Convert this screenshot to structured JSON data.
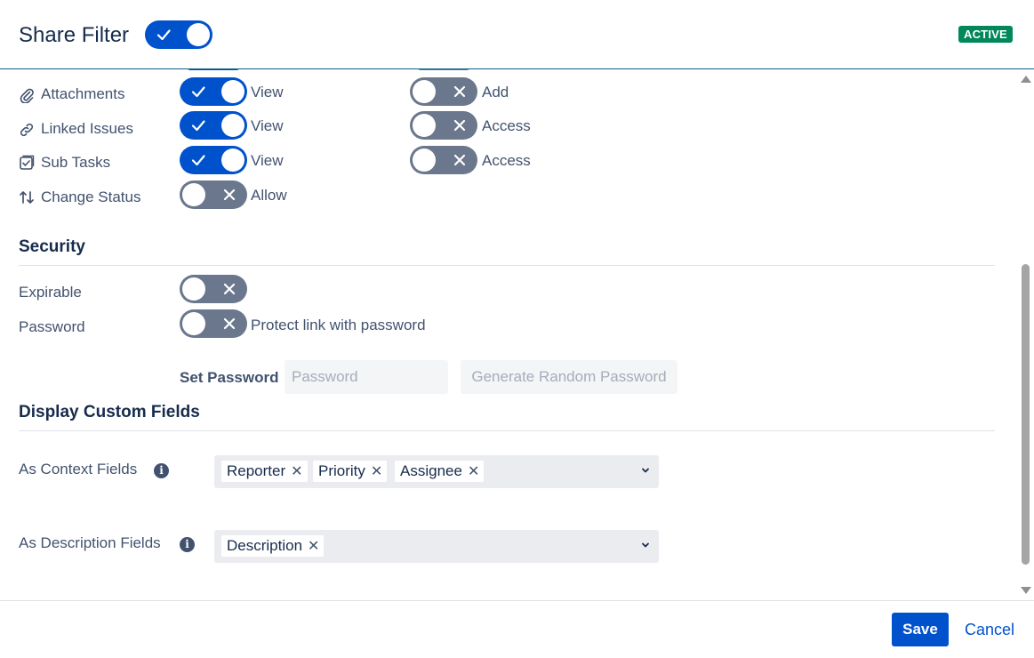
{
  "header": {
    "title": "Share Filter",
    "share_toggle": "on",
    "status_badge": "ACTIVE"
  },
  "permissions": {
    "rows": [
      {
        "label": "Attachments",
        "icon": "paperclip-icon",
        "primary": {
          "state": "on",
          "label": "View"
        },
        "secondary": {
          "state": "off",
          "label": "Add"
        }
      },
      {
        "label": "Linked Issues",
        "icon": "link-icon",
        "primary": {
          "state": "on",
          "label": "View"
        },
        "secondary": {
          "state": "off",
          "label": "Access"
        }
      },
      {
        "label": "Sub Tasks",
        "icon": "subtask-icon",
        "primary": {
          "state": "on",
          "label": "View"
        },
        "secondary": {
          "state": "off",
          "label": "Access"
        }
      },
      {
        "label": "Change Status",
        "icon": "swap-arrows-icon",
        "primary": {
          "state": "off",
          "label": "Allow"
        }
      }
    ]
  },
  "security": {
    "title": "Security",
    "expirable_label": "Expirable",
    "expirable_state": "off",
    "password_label": "Password",
    "password_state": "off",
    "password_toggle_text": "Protect link with password",
    "set_password_label": "Set Password",
    "password_placeholder": "Password",
    "generate_button": "Generate Random Password"
  },
  "custom_fields": {
    "title": "Display Custom Fields",
    "context_label": "As Context Fields",
    "context_tags": [
      "Reporter",
      "Priority",
      "Assignee"
    ],
    "description_label": "As Description Fields",
    "description_tags": [
      "Description"
    ]
  },
  "footer": {
    "save": "Save",
    "cancel": "Cancel"
  },
  "colors": {
    "primary": "#0052cc",
    "toggle_off": "#6b778c",
    "badge": "#00875a"
  }
}
